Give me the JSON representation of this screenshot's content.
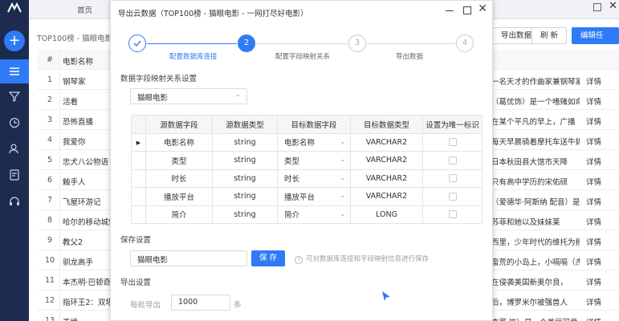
{
  "app": {
    "tab_home": "首页"
  },
  "sidebar": {
    "add_label": "+"
  },
  "background": {
    "breadcrumb": "TOP100榜 - 猫眼电影",
    "buttons": {
      "export": "导出数据",
      "refresh": "刷 新",
      "edit": "编辑任务"
    },
    "table": {
      "headers": {
        "num": "#",
        "name": "电影名称"
      },
      "rows": [
        {
          "num": "1",
          "name": "钢琴家",
          "desc": "一名天才的作曲家兼钢琴家",
          "action": "详情"
        },
        {
          "num": "2",
          "name": "活着",
          "desc": "（葛优饰）是一个嗜赌如命",
          "action": "详情"
        },
        {
          "num": "3",
          "name": "恐怖直播",
          "desc": "在某个平凡的早上，广播",
          "action": "详情"
        },
        {
          "num": "4",
          "name": "我爱你",
          "desc": "每天早晨骑着摩托车送牛奶的金",
          "action": "详情"
        },
        {
          "num": "5",
          "name": "忠犬八公物语",
          "desc": "日本秋田县大馆市天降",
          "action": "详情"
        },
        {
          "num": "6",
          "name": "触手人",
          "desc": "只有高中学历的宋佑硕",
          "action": "详情"
        },
        {
          "num": "7",
          "name": "飞屋环游记",
          "desc": "（爱德华·阿斯纳 配音）是一",
          "action": "详情"
        },
        {
          "num": "8",
          "name": "哈尔的移动城堡",
          "desc": "苏菲和她以及妹妹莱",
          "action": "详情"
        },
        {
          "num": "9",
          "name": "教父2",
          "desc": "西里，少年时代的维托为报",
          "action": "详情"
        },
        {
          "num": "10",
          "name": "驯龙高手",
          "desc": "蛮荒的小岛上，小嗝嗝（杰伊·巴",
          "action": "详情"
        },
        {
          "num": "11",
          "name": "本杰明·巴顿奇事",
          "desc": "在侵袭美国新奥尔良，",
          "action": "详情"
        },
        {
          "num": "12",
          "name": "指环王2：双塔奇兵",
          "desc": "后，博罗米尔被强兽人",
          "action": "详情"
        },
        {
          "num": "13",
          "name": "素媛",
          "desc": "李菜 饰）是一个美丽可爱",
          "action": "详情"
        }
      ]
    }
  },
  "modal": {
    "title": "导出云数据（TOP100榜 - 猫眼电影 - 一网打尽好电影）",
    "steps": [
      {
        "icon": "check-icon",
        "label": ""
      },
      {
        "number": "2",
        "label": "配置数据库连接"
      },
      {
        "number": "3",
        "label": "配置字段映射关系"
      },
      {
        "number": "4",
        "label": "导出数据"
      }
    ],
    "mapping_section": "数据字段映射关系设置",
    "source_select": "猫眼电影",
    "mapping_table": {
      "headers": [
        "源数据字段",
        "源数据类型",
        "目标数据字段",
        "目标数据类型",
        "设置为唯一标识"
      ],
      "rows": [
        {
          "source_field": "电影名称",
          "source_type": "string",
          "target_field": "电影名称",
          "target_type": "VARCHAR2"
        },
        {
          "source_field": "类型",
          "source_type": "string",
          "target_field": "类型",
          "target_type": "VARCHAR2"
        },
        {
          "source_field": "时长",
          "source_type": "string",
          "target_field": "时长",
          "target_type": "VARCHAR2"
        },
        {
          "source_field": "播放平台",
          "source_type": "string",
          "target_field": "播放平台",
          "target_type": "VARCHAR2"
        },
        {
          "source_field": "简介",
          "source_type": "string",
          "target_field": "简介",
          "target_type": "LONG"
        }
      ]
    },
    "save_section": "保存设置",
    "save_name": "猫眼电影",
    "save_button": "保 存",
    "save_hint": "可对数据库连接和字段映射信息进行保存",
    "export_section": "导出设置",
    "batch_label": "每批导出",
    "batch_value": "1000",
    "batch_unit": "条"
  },
  "colors": {
    "accent": "#2f7bf5",
    "sidebar": "#1d2b4f"
  }
}
